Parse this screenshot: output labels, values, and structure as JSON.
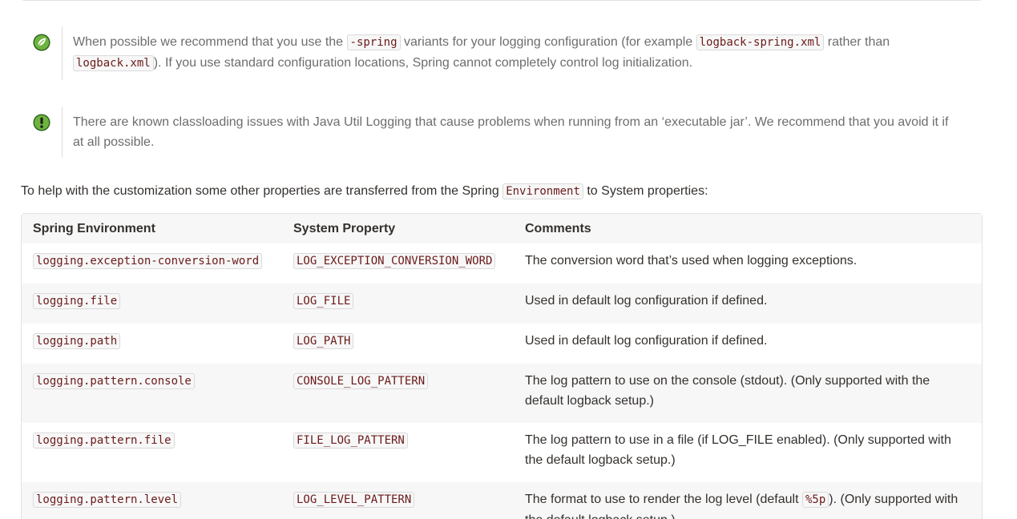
{
  "tip": {
    "icon": "spring-leaf-icon",
    "icon_color": "#6db33f",
    "text_before": "When possible we recommend that you use the ",
    "code1": "-spring",
    "text_mid1": " variants for your logging configuration (for example ",
    "code2": "logback-spring.xml",
    "text_mid2": " rather than ",
    "code3": "logback.xml",
    "text_after": "). If you use standard configuration locations, Spring cannot completely control log initialization."
  },
  "warning": {
    "icon": "exclamation-icon",
    "text": "There are known classloading issues with Java Util Logging that cause problems when running from an ‘executable jar’. We recommend that you avoid it if at all possible."
  },
  "intro": {
    "text_before": "To help with the customization some other properties are transferred from the Spring ",
    "code": "Environment",
    "text_after": " to System properties:"
  },
  "table": {
    "headers": [
      "Spring Environment",
      "System Property",
      "Comments"
    ],
    "rows": [
      {
        "env": "logging.exception-conversion-word",
        "prop": "LOG_EXCEPTION_CONVERSION_WORD",
        "comment": "The conversion word that’s used when logging exceptions."
      },
      {
        "env": "logging.file",
        "prop": "LOG_FILE",
        "comment": "Used in default log configuration if defined."
      },
      {
        "env": "logging.path",
        "prop": "LOG_PATH",
        "comment": "Used in default log configuration if defined."
      },
      {
        "env": "logging.pattern.console",
        "prop": "CONSOLE_LOG_PATTERN",
        "comment": "The log pattern to use on the console (stdout). (Only supported with the default logback setup.)"
      },
      {
        "env": "logging.pattern.file",
        "prop": "FILE_LOG_PATTERN",
        "comment": "The log pattern to use in a file (if LOG_FILE enabled). (Only supported with the default logback setup.)"
      },
      {
        "env": "logging.pattern.level",
        "prop": "LOG_LEVEL_PATTERN",
        "comment_before": "The format to use to render the log level (default ",
        "comment_code": "%5p",
        "comment_after": "). (Only supported with the default logback setup.)"
      }
    ]
  }
}
